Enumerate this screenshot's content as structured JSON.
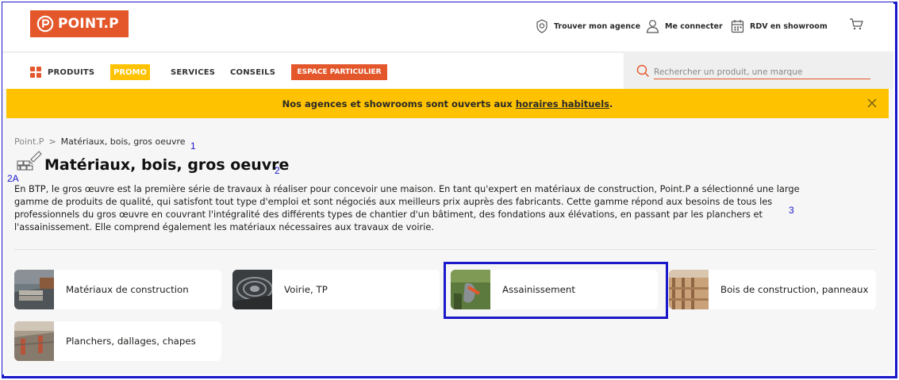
{
  "header": {
    "logo_text": "POINT.P",
    "links": [
      {
        "label": "Trouver mon agence",
        "icon": "location-shield-icon"
      },
      {
        "label": "Me connecter",
        "icon": "user-icon"
      },
      {
        "label": "RDV en showroom",
        "icon": "calendar-icon"
      }
    ],
    "cart_icon": "cart-icon"
  },
  "nav": {
    "produits": "PRODUITS",
    "promo": "PROMO",
    "services": "SERVICES",
    "conseils": "CONSEILS",
    "espace": "ESPACE PARTICULIER",
    "search_placeholder": "Rechercher un produit, une marque"
  },
  "banner": {
    "text": "Nos agences et showrooms sont ouverts aux",
    "link": "horaires habituels",
    "end": "."
  },
  "breadcrumb": {
    "home": "Point.P",
    "separator": ">",
    "current": "Matériaux, bois, gros oeuvre"
  },
  "annotations": {
    "a1": "1",
    "a2": "2",
    "a2A": "2A",
    "a3": "3"
  },
  "page": {
    "title": "Matériaux, bois, gros oeuvre",
    "description": "En BTP, le gros œuvre est la première série de travaux à réaliser pour concevoir une maison. En tant qu'expert en matériaux de construction, Point.P a sélectionné une large gamme de produits de qualité, qui satisfont tout type d'emploi et sont négociés aux meilleurs prix auprès des fabricants. Cette gamme répond aux besoins de tous les professionnels du gros œuvre en couvrant l'intégralité des différents types de chantier d'un bâtiment, des fondations aux élévations, en passant par les planchers et l'assainissement. Elle comprend également les matériaux nécessaires aux travaux de voirie."
  },
  "categories": [
    {
      "label": "Matériaux de construction"
    },
    {
      "label": "Voirie, TP"
    },
    {
      "label": "Assainissement"
    },
    {
      "label": "Bois de construction, panneaux"
    },
    {
      "label": "Planchers, dallages, chapes"
    }
  ],
  "colors": {
    "brand_orange": "#e3572b",
    "promo_yellow": "#ffc200",
    "annotation_blue": "#1a18c9"
  }
}
